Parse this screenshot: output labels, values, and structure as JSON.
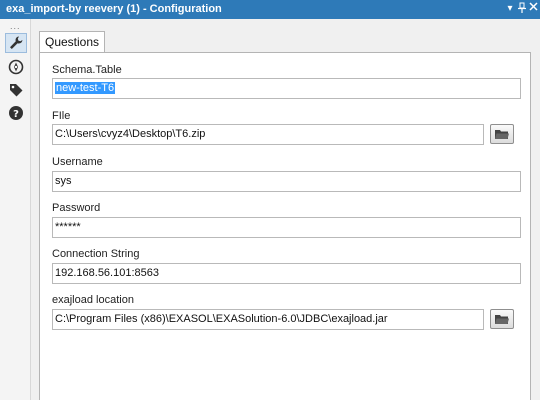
{
  "window": {
    "title": "exa_import-by reevery (1) - Configuration",
    "controls": [
      "dropdown-icon",
      "pin-icon",
      "close-icon"
    ]
  },
  "sidebar": {
    "overflow": "...",
    "tools": [
      {
        "icon": "wrench-icon",
        "active": true
      },
      {
        "icon": "compass-icon",
        "active": false
      },
      {
        "icon": "tag-icon",
        "active": false
      },
      {
        "icon": "help-icon",
        "active": false
      }
    ]
  },
  "tabs": [
    {
      "label": "Questions",
      "active": true
    }
  ],
  "form": {
    "schema_table": {
      "label": "Schema.Table",
      "value": "new-test-T6"
    },
    "file": {
      "label": "FIle",
      "value": "C:\\Users\\cvyz4\\Desktop\\T6.zip"
    },
    "username": {
      "label": "Username",
      "value": "sys"
    },
    "password": {
      "label": "Password",
      "value": "******"
    },
    "connection_string": {
      "label": "Connection String",
      "value": "192.168.56.101:8563"
    },
    "exajload_location": {
      "label": "exajload location",
      "value": "C:\\Program Files (x86)\\EXASOL\\EXASolution-6.0\\JDBC\\exajload.jar"
    }
  },
  "colors": {
    "titlebar": "#2e7ab8",
    "selection": "#3399ff",
    "panel_border": "#b4b4b4"
  }
}
